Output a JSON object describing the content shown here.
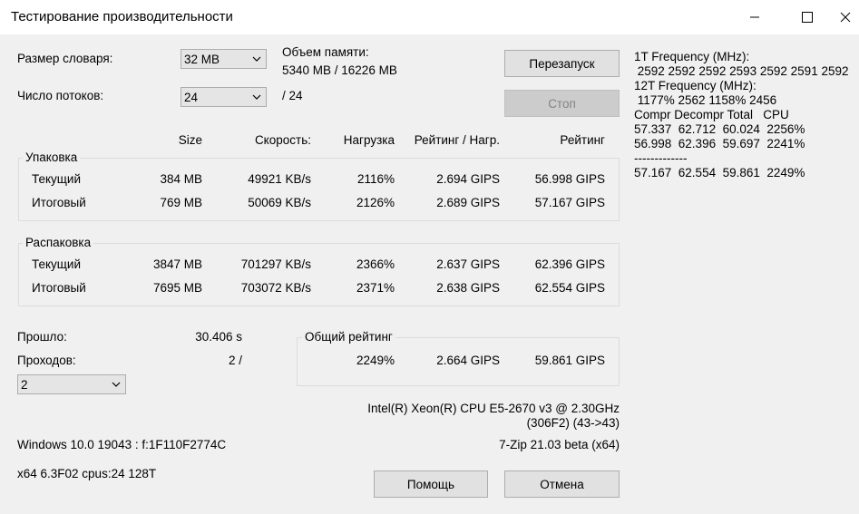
{
  "window": {
    "title": "Тестирование производительности",
    "minimize_icon": "minimize-icon",
    "maximize_icon": "maximize-icon",
    "close_icon": "close-icon"
  },
  "settings": {
    "dict_label": "Размер словаря:",
    "dict_value": "32 MB",
    "threads_label": "Число потоков:",
    "threads_value": "24",
    "threads_total": "/ 24",
    "memory_label": "Объем памяти:",
    "memory_value": "5340 MB / 16226 MB"
  },
  "buttons": {
    "restart": "Перезапуск",
    "stop": "Стоп",
    "help": "Помощь",
    "cancel": "Отмена"
  },
  "columns": [
    "Size",
    "Скорость:",
    "Нагрузка",
    "Рейтинг / Нагр.",
    "Рейтинг"
  ],
  "packing": {
    "label": "Упаковка",
    "rows": [
      {
        "name": "Текущий",
        "size": "384 MB",
        "speed": "49921 KB/s",
        "load": "2116%",
        "rating_per_load": "2.694 GIPS",
        "rating": "56.998 GIPS"
      },
      {
        "name": "Итоговый",
        "size": "769 MB",
        "speed": "50069 KB/s",
        "load": "2126%",
        "rating_per_load": "2.689 GIPS",
        "rating": "57.167 GIPS"
      }
    ]
  },
  "unpacking": {
    "label": "Распаковка",
    "rows": [
      {
        "name": "Текущий",
        "size": "3847 MB",
        "speed": "701297 KB/s",
        "load": "2366%",
        "rating_per_load": "2.637 GIPS",
        "rating": "62.396 GIPS"
      },
      {
        "name": "Итоговый",
        "size": "7695 MB",
        "speed": "703072 KB/s",
        "load": "2371%",
        "rating_per_load": "2.638 GIPS",
        "rating": "62.554 GIPS"
      }
    ]
  },
  "elapsed": {
    "label": "Прошло:",
    "value": "30.406 s"
  },
  "passes": {
    "label": "Проходов:",
    "value": "2 /",
    "combo_value": "2"
  },
  "total": {
    "label": "Общий рейтинг",
    "load": "2249%",
    "rating_per_load": "2.664 GIPS",
    "rating": "59.861 GIPS"
  },
  "cpu": {
    "line1": "Intel(R) Xeon(R) CPU E5-2670 v3 @ 2.30GHz",
    "line2": "(306F2) (43->43)"
  },
  "os": {
    "line1": "Windows 10.0 19043 :  f:1F110F2774C",
    "line2": "x64 6.3F02 cpus:24 128T"
  },
  "version": "7-Zip 21.03 beta (x64)",
  "freq_log": [
    "1T Frequency (MHz):",
    " 2592 2592 2592 2593 2592 2591 2592",
    "12T Frequency (MHz):",
    " 1177% 2562 1158% 2456",
    "Compr Decompr Total   CPU",
    "57.337  62.712  60.024  2256%",
    "56.998  62.396  59.697  2241%",
    "-------------",
    "57.167  62.554  59.861  2249%"
  ]
}
